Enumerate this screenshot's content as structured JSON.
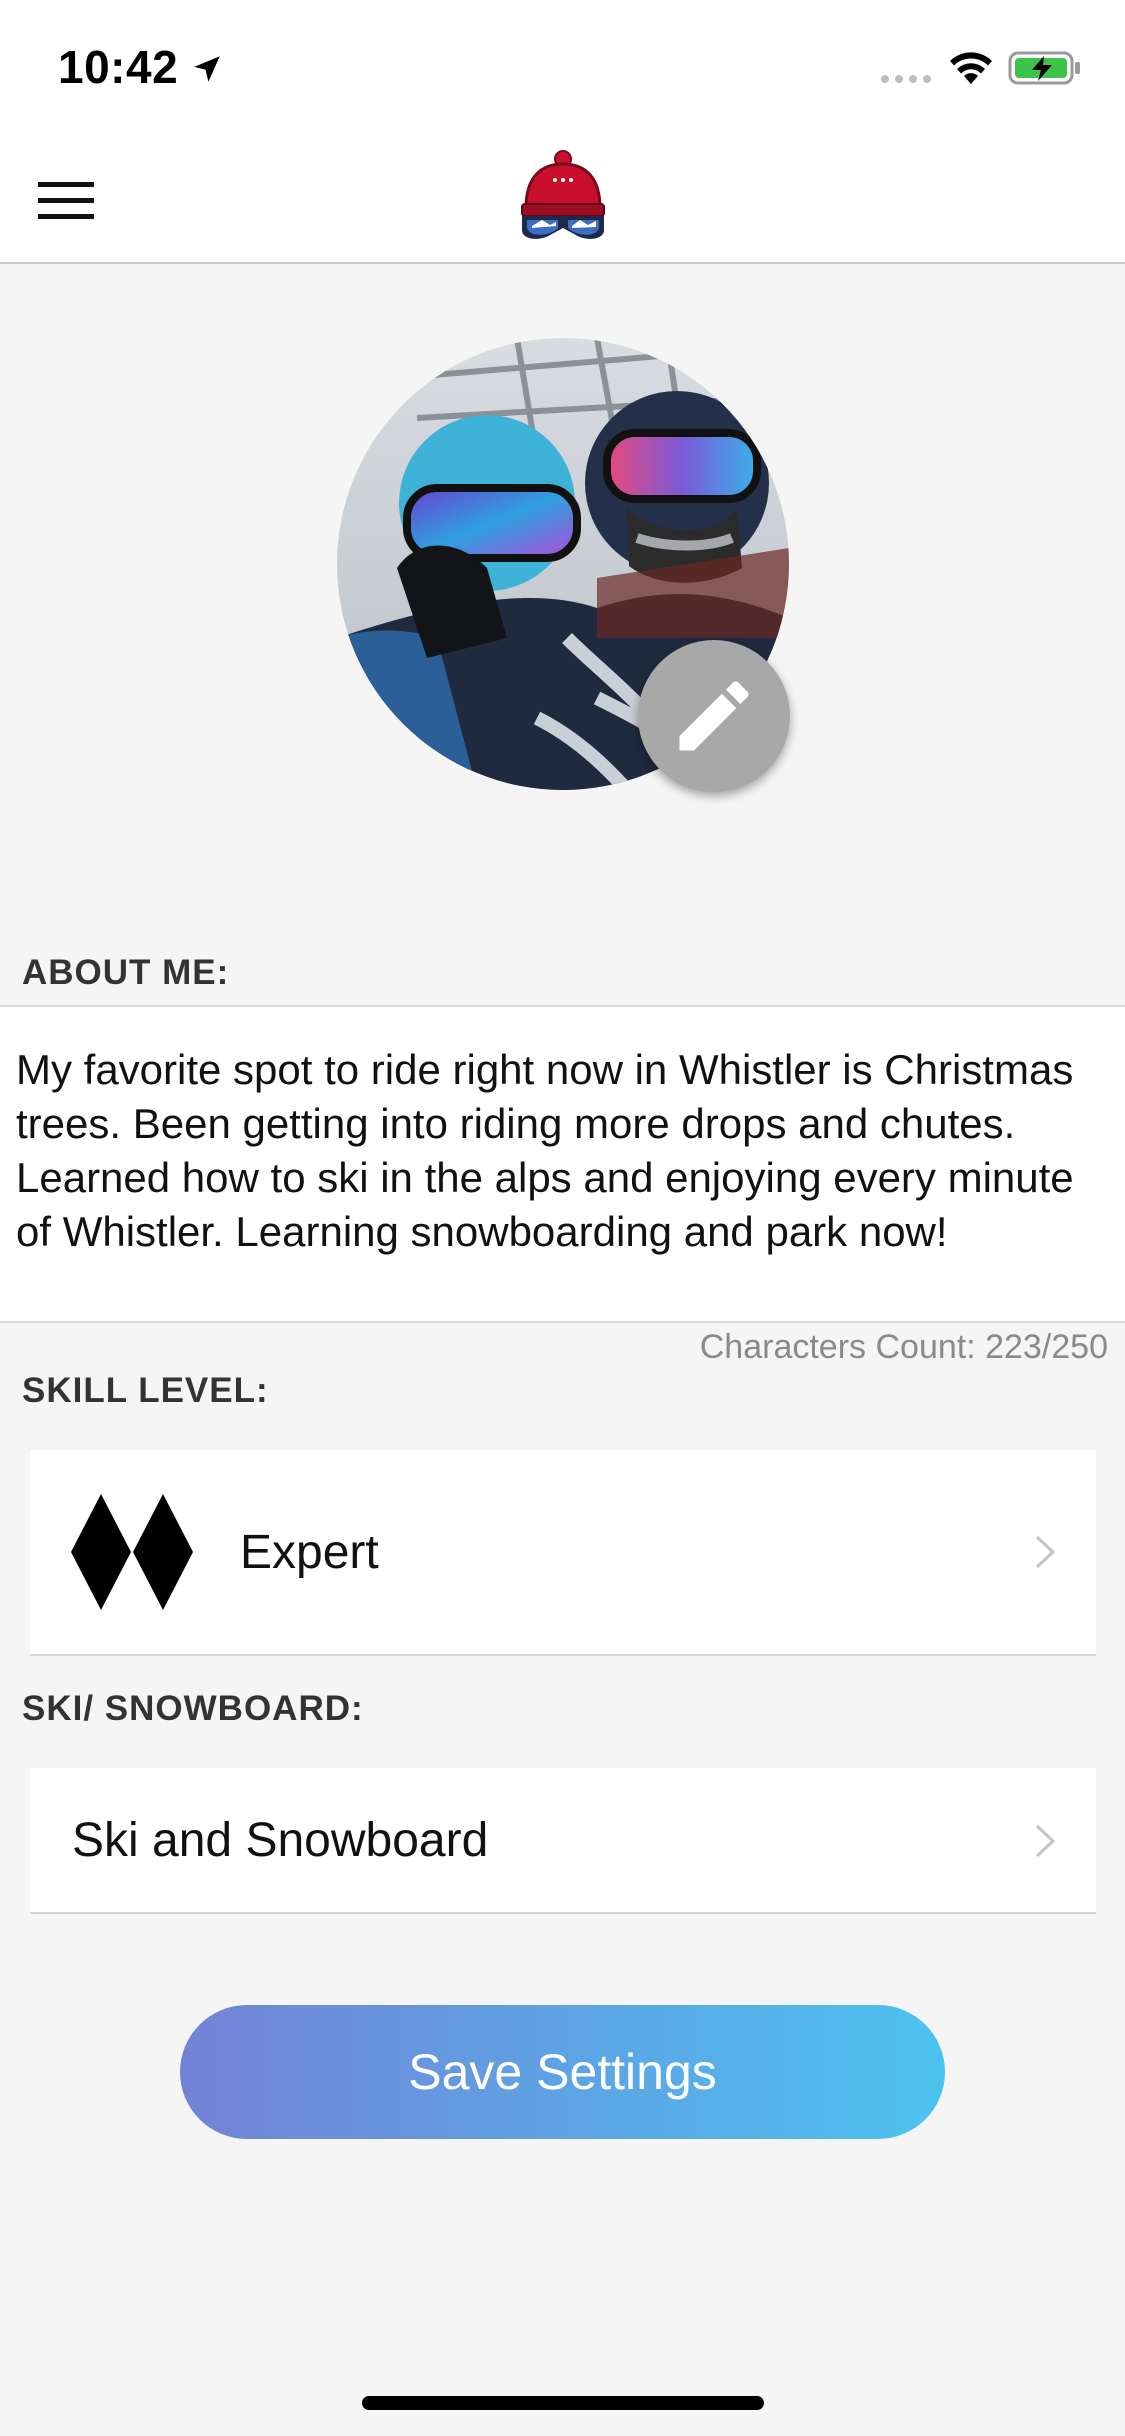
{
  "status_bar": {
    "time": "10:42"
  },
  "icons": {
    "menu": "hamburger-menu-icon",
    "logo": "ski-beanie-goggles-logo",
    "edit": "pencil-icon",
    "skill": "double-black-diamond-icon",
    "chevron": "chevron-right-icon"
  },
  "colors": {
    "accent_start": "#7482d6",
    "accent_end": "#4dc3ef",
    "logo_red": "#c8102e"
  },
  "about": {
    "label": "ABOUT ME:",
    "text": "My favorite spot to ride right now in Whistler is Christmas trees.  Been getting into riding more drops and chutes.  Learned how to ski in the alps and enjoying every minute of Whistler.  Learning snowboarding and park now!",
    "char_count": "Characters Count: 223/250"
  },
  "skill": {
    "label": "SKILL LEVEL:",
    "value": "Expert"
  },
  "sport": {
    "label": "SKI/ SNOWBOARD:",
    "value": "Ski and Snowboard"
  },
  "save_button": {
    "label": "Save Settings"
  }
}
